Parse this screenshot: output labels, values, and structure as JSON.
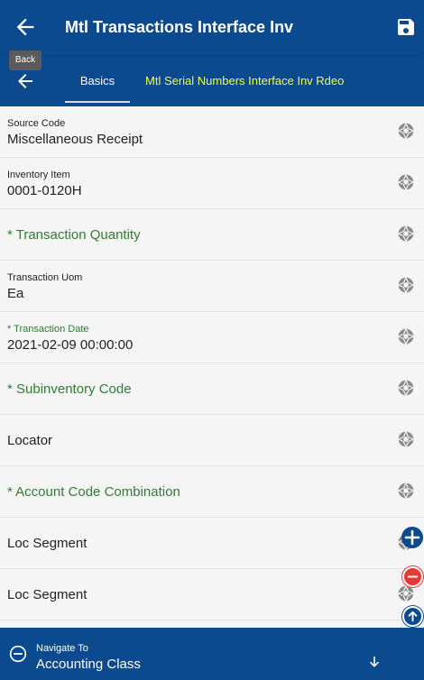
{
  "header": {
    "title": "Mtl Transactions Interface Inv",
    "back_tooltip": "Back"
  },
  "tabs": {
    "basics": "Basics",
    "serial": "Mtl Serial Numbers Interface Inv Rdeo"
  },
  "fields": [
    {
      "label": "Source Code",
      "value": "Miscellaneous Receipt",
      "required": false
    },
    {
      "label": "Inventory Item",
      "value": "0001-0120H",
      "required": false
    },
    {
      "label": "* Transaction Quantity",
      "value": "",
      "required": true
    },
    {
      "label": "Transaction Uom",
      "value": "Ea",
      "required": false
    },
    {
      "label": "* Transaction Date",
      "value": "2021-02-09 00:00:00",
      "required": true
    },
    {
      "label": "* Subinventory Code",
      "value": "",
      "required": true
    },
    {
      "label": "Locator",
      "value": "",
      "required": false
    },
    {
      "label": "* Account Code Combination",
      "value": "",
      "required": true
    },
    {
      "label": "Loc Segment",
      "value": "",
      "required": false
    },
    {
      "label": "Loc Segment",
      "value": "",
      "required": false
    }
  ],
  "bottom_nav": {
    "label": "Navigate To",
    "value": "Accounting Class"
  },
  "colors": {
    "primary": "#0b4a8e",
    "required": "#2e7d32",
    "serial_tab": "#e8ff4a",
    "danger": "#e53935"
  },
  "icons": {
    "back": "back-arrow-icon",
    "save": "save-icon",
    "field_action": "aperture-icon",
    "add": "plus-icon",
    "remove": "minus-icon",
    "up": "arrow-up-icon",
    "nav": "minus-circle-icon",
    "nav_expand": "arrow-down-icon"
  }
}
